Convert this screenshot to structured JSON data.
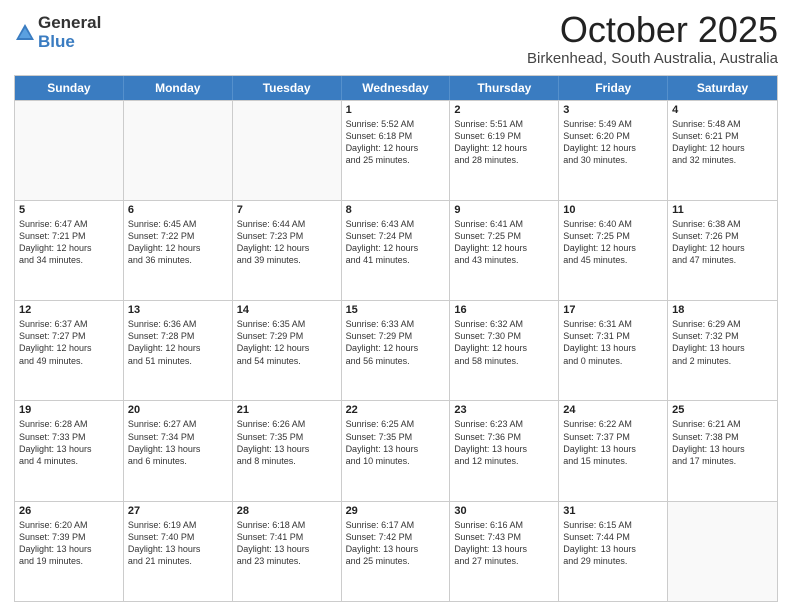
{
  "logo": {
    "general": "General",
    "blue": "Blue"
  },
  "header": {
    "month": "October 2025",
    "location": "Birkenhead, South Australia, Australia"
  },
  "days": [
    "Sunday",
    "Monday",
    "Tuesday",
    "Wednesday",
    "Thursday",
    "Friday",
    "Saturday"
  ],
  "weeks": [
    [
      {
        "day": "",
        "info": ""
      },
      {
        "day": "",
        "info": ""
      },
      {
        "day": "",
        "info": ""
      },
      {
        "day": "1",
        "info": "Sunrise: 5:52 AM\nSunset: 6:18 PM\nDaylight: 12 hours\nand 25 minutes."
      },
      {
        "day": "2",
        "info": "Sunrise: 5:51 AM\nSunset: 6:19 PM\nDaylight: 12 hours\nand 28 minutes."
      },
      {
        "day": "3",
        "info": "Sunrise: 5:49 AM\nSunset: 6:20 PM\nDaylight: 12 hours\nand 30 minutes."
      },
      {
        "day": "4",
        "info": "Sunrise: 5:48 AM\nSunset: 6:21 PM\nDaylight: 12 hours\nand 32 minutes."
      }
    ],
    [
      {
        "day": "5",
        "info": "Sunrise: 6:47 AM\nSunset: 7:21 PM\nDaylight: 12 hours\nand 34 minutes."
      },
      {
        "day": "6",
        "info": "Sunrise: 6:45 AM\nSunset: 7:22 PM\nDaylight: 12 hours\nand 36 minutes."
      },
      {
        "day": "7",
        "info": "Sunrise: 6:44 AM\nSunset: 7:23 PM\nDaylight: 12 hours\nand 39 minutes."
      },
      {
        "day": "8",
        "info": "Sunrise: 6:43 AM\nSunset: 7:24 PM\nDaylight: 12 hours\nand 41 minutes."
      },
      {
        "day": "9",
        "info": "Sunrise: 6:41 AM\nSunset: 7:25 PM\nDaylight: 12 hours\nand 43 minutes."
      },
      {
        "day": "10",
        "info": "Sunrise: 6:40 AM\nSunset: 7:25 PM\nDaylight: 12 hours\nand 45 minutes."
      },
      {
        "day": "11",
        "info": "Sunrise: 6:38 AM\nSunset: 7:26 PM\nDaylight: 12 hours\nand 47 minutes."
      }
    ],
    [
      {
        "day": "12",
        "info": "Sunrise: 6:37 AM\nSunset: 7:27 PM\nDaylight: 12 hours\nand 49 minutes."
      },
      {
        "day": "13",
        "info": "Sunrise: 6:36 AM\nSunset: 7:28 PM\nDaylight: 12 hours\nand 51 minutes."
      },
      {
        "day": "14",
        "info": "Sunrise: 6:35 AM\nSunset: 7:29 PM\nDaylight: 12 hours\nand 54 minutes."
      },
      {
        "day": "15",
        "info": "Sunrise: 6:33 AM\nSunset: 7:29 PM\nDaylight: 12 hours\nand 56 minutes."
      },
      {
        "day": "16",
        "info": "Sunrise: 6:32 AM\nSunset: 7:30 PM\nDaylight: 12 hours\nand 58 minutes."
      },
      {
        "day": "17",
        "info": "Sunrise: 6:31 AM\nSunset: 7:31 PM\nDaylight: 13 hours\nand 0 minutes."
      },
      {
        "day": "18",
        "info": "Sunrise: 6:29 AM\nSunset: 7:32 PM\nDaylight: 13 hours\nand 2 minutes."
      }
    ],
    [
      {
        "day": "19",
        "info": "Sunrise: 6:28 AM\nSunset: 7:33 PM\nDaylight: 13 hours\nand 4 minutes."
      },
      {
        "day": "20",
        "info": "Sunrise: 6:27 AM\nSunset: 7:34 PM\nDaylight: 13 hours\nand 6 minutes."
      },
      {
        "day": "21",
        "info": "Sunrise: 6:26 AM\nSunset: 7:35 PM\nDaylight: 13 hours\nand 8 minutes."
      },
      {
        "day": "22",
        "info": "Sunrise: 6:25 AM\nSunset: 7:35 PM\nDaylight: 13 hours\nand 10 minutes."
      },
      {
        "day": "23",
        "info": "Sunrise: 6:23 AM\nSunset: 7:36 PM\nDaylight: 13 hours\nand 12 minutes."
      },
      {
        "day": "24",
        "info": "Sunrise: 6:22 AM\nSunset: 7:37 PM\nDaylight: 13 hours\nand 15 minutes."
      },
      {
        "day": "25",
        "info": "Sunrise: 6:21 AM\nSunset: 7:38 PM\nDaylight: 13 hours\nand 17 minutes."
      }
    ],
    [
      {
        "day": "26",
        "info": "Sunrise: 6:20 AM\nSunset: 7:39 PM\nDaylight: 13 hours\nand 19 minutes."
      },
      {
        "day": "27",
        "info": "Sunrise: 6:19 AM\nSunset: 7:40 PM\nDaylight: 13 hours\nand 21 minutes."
      },
      {
        "day": "28",
        "info": "Sunrise: 6:18 AM\nSunset: 7:41 PM\nDaylight: 13 hours\nand 23 minutes."
      },
      {
        "day": "29",
        "info": "Sunrise: 6:17 AM\nSunset: 7:42 PM\nDaylight: 13 hours\nand 25 minutes."
      },
      {
        "day": "30",
        "info": "Sunrise: 6:16 AM\nSunset: 7:43 PM\nDaylight: 13 hours\nand 27 minutes."
      },
      {
        "day": "31",
        "info": "Sunrise: 6:15 AM\nSunset: 7:44 PM\nDaylight: 13 hours\nand 29 minutes."
      },
      {
        "day": "",
        "info": ""
      }
    ]
  ]
}
